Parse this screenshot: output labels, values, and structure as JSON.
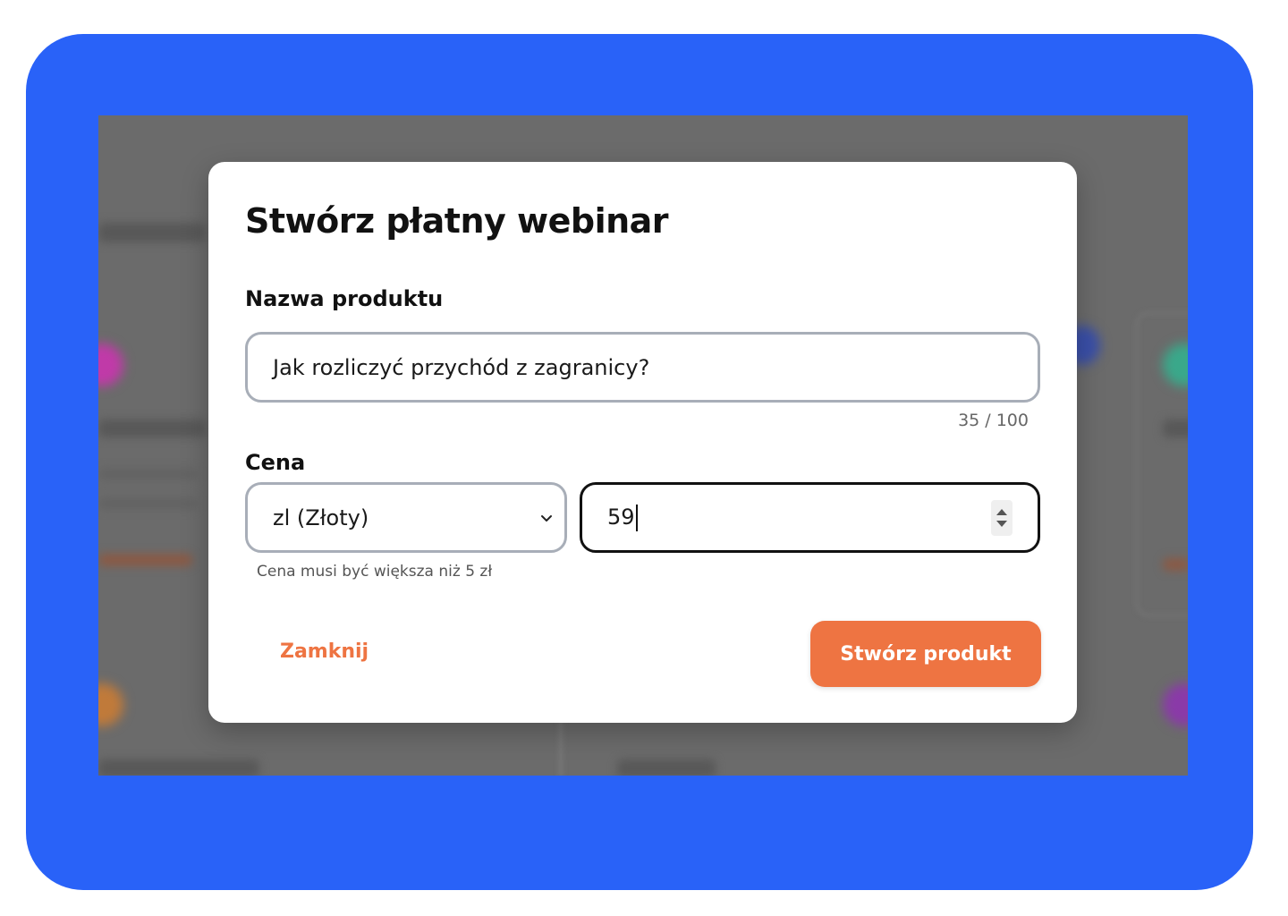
{
  "modal": {
    "title": "Stwórz płatny webinar",
    "name_label": "Nazwa produktu",
    "name_value": "Jak rozliczyć przychód z zagranicy?",
    "name_counter": "35 / 100",
    "price_label": "Cena",
    "currency_value": "zl (Złoty)",
    "price_value": "59",
    "price_hint": "Cena musi być większa niż 5 zł",
    "close_label": "Zamknij",
    "submit_label": "Stwórz produkt"
  },
  "colors": {
    "frame": "#2962f8",
    "accent": "#ee7442",
    "overlay": "#6b6b6b"
  },
  "icons": {
    "select_arrow": "chevron-down-icon",
    "stepper": "spin-arrows-icon"
  }
}
